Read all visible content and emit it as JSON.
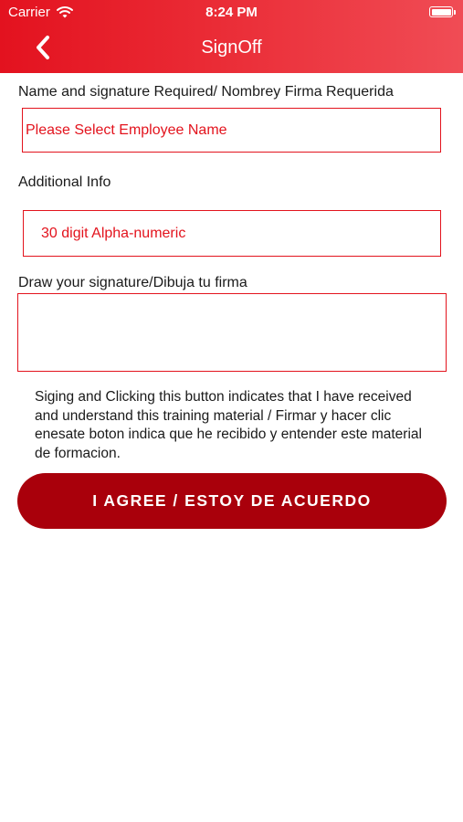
{
  "status_bar": {
    "carrier": "Carrier",
    "time": "8:24 PM"
  },
  "nav": {
    "title": "SignOff",
    "back_icon": "chevron-left-icon"
  },
  "form": {
    "name_label": "Name and signature Required/ Nombrey Firma Requerida",
    "employee_placeholder": "Please Select Employee Name",
    "additional_label": "Additional Info",
    "additional_placeholder": "30 digit Alpha-numeric",
    "signature_label": "Draw your signature/Dibuja tu firma"
  },
  "disclaimer": "Siging and Clicking this button indicates that I have received and understand this training material / Firmar y hacer clic enesate boton indica que he recibido y entender este material de formacion.",
  "agree_button": "I AGREE / ESTOY DE ACUERDO",
  "colors": {
    "header_gradient_start": "#e3121f",
    "header_gradient_end": "#f04c55",
    "accent_red": "#e3131d",
    "button_red": "#a9000b"
  }
}
